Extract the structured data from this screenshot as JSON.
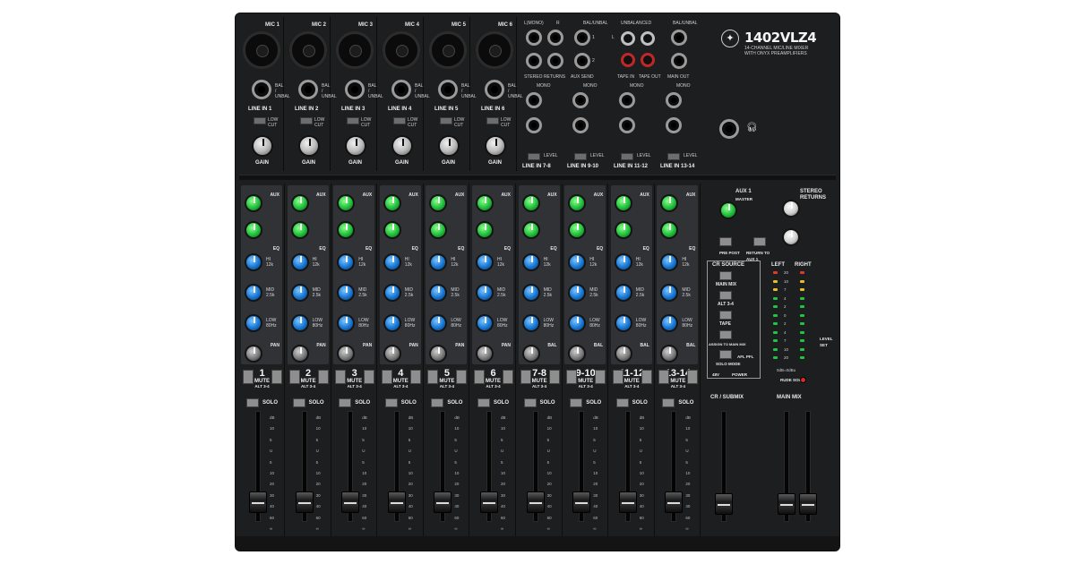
{
  "product": {
    "model": "1402VLZ4",
    "description": [
      "14-CHANNEL MIC/LINE MIXER",
      "WITH ONYX PREAMPLIFIERS"
    ]
  },
  "mic_inputs": [
    {
      "label": "MIC 1",
      "line": "LINE IN 1"
    },
    {
      "label": "MIC 2",
      "line": "LINE IN 2"
    },
    {
      "label": "MIC 3",
      "line": "LINE IN 3"
    },
    {
      "label": "MIC 4",
      "line": "LINE IN 4"
    },
    {
      "label": "MIC 5",
      "line": "LINE IN 5"
    },
    {
      "label": "MIC 6",
      "line": "LINE IN 6"
    }
  ],
  "input_labels": {
    "bal_unbal": "BAL / UNBAL",
    "low_cut": "LOW CUT",
    "low_cut_freq": "75 Hz",
    "gain": "GAIN"
  },
  "io_right": {
    "l_mono": "L(MONO)",
    "r": "R",
    "bal_unbal": "BAL/UNBAL",
    "unbalanced": "UNBALANCED",
    "stereo_returns": "STEREO RETURNS",
    "aux_send": "AUX SEND",
    "tape_in": "TAPE IN",
    "tape_out": "TAPE OUT",
    "main_out": "MAIN OUT",
    "mono": "MONO",
    "level": "LEVEL",
    "stereo_lines": [
      "LINE IN 7-8",
      "LINE IN 9-10",
      "LINE IN 11-12",
      "LINE IN 13-14"
    ],
    "l": "L",
    "num1": "1",
    "num2": "2"
  },
  "strip_labels": {
    "aux": "AUX",
    "eq": "EQ",
    "hi": "HI",
    "hi_freq": "12k",
    "mid": "MID",
    "mid_freq": "2.5k",
    "low": "LOW",
    "low_freq": "80Hz",
    "pan": "PAN",
    "bal": "BAL",
    "mute": "MUTE",
    "alt": "ALT 3-4",
    "solo": "SOLO"
  },
  "channels": [
    "1",
    "2",
    "3",
    "4",
    "5",
    "6",
    "7-8",
    "9-10",
    "11-12",
    "13-14"
  ],
  "fader_scale": [
    "dB",
    "10",
    "5",
    "U",
    "5",
    "10",
    "20",
    "30",
    "40",
    "60",
    "∞"
  ],
  "master": {
    "aux1": "AUX 1",
    "aux1_sub": "MASTER",
    "pre_post": "PRE POST",
    "return_to_aux": "RETURN TO AUX 1",
    "stereo_returns": "STEREO RETURNS",
    "cr_source": "CR SOURCE",
    "main_mix": "MAIN MIX",
    "alt34": "ALT 3-4",
    "tape": "TAPE",
    "assign": "ASSIGN TO MAIN MIX",
    "solo_mode": "SOLO MODE",
    "afl_pfl": "AFL PFL",
    "phantom": "48V",
    "power": "POWER",
    "left": "LEFT",
    "right": "RIGHT",
    "level_set": "LEVEL SET",
    "rude_solo": "RUDE SOLO",
    "cr_submix": "CR / SUBMIX",
    "main_mix_fader": "MAIN MIX",
    "meter": [
      "20",
      "10",
      "7",
      "4",
      "2",
      "0",
      "2",
      "4",
      "7",
      "10",
      "20"
    ],
    "zero_db": "0dB=0dBu"
  },
  "colors": {
    "aux_knob": "#1fbf3a",
    "eq_knob": "#1677d4",
    "chassis": "#1d1e20"
  }
}
